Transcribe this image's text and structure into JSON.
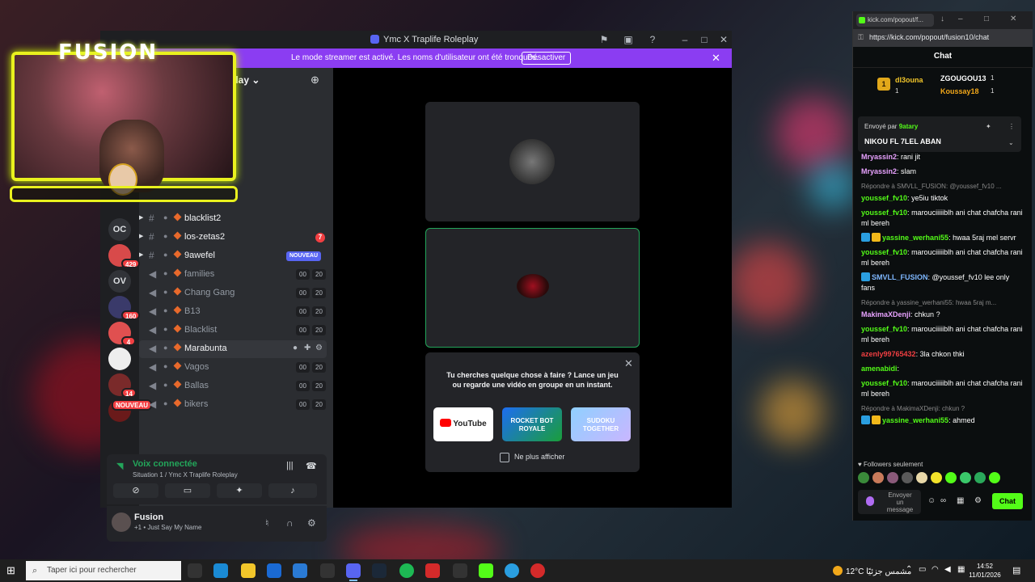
{
  "overlay": {
    "title": "FUSION"
  },
  "discord": {
    "window_title": "Ymc X Traplife Roleplay",
    "banner": {
      "message": "Le mode streamer est activé. Les noms d'utilisateur ont été tronqués.",
      "button": "Désactiver"
    },
    "guild_header": "play ⌄",
    "servers": [
      {
        "label": "OC"
      },
      {
        "label": "",
        "badge": "429"
      },
      {
        "label": "OV"
      },
      {
        "label": "",
        "badge": "160"
      },
      {
        "label": "",
        "badge": "4"
      },
      {
        "label": "",
        "badge": ""
      },
      {
        "label": "",
        "badge": "14"
      },
      {
        "label": "",
        "badge": "NOUVEAU"
      }
    ],
    "channels": [
      {
        "name": "blacklist2",
        "type": "text"
      },
      {
        "name": "los-zetas2",
        "type": "text",
        "unread": "7"
      },
      {
        "name": "9awefel",
        "type": "text",
        "nouveau": "NOUVEAU"
      },
      {
        "name": "families",
        "type": "voice",
        "c1": "00",
        "c2": "20"
      },
      {
        "name": "Chang Gang",
        "type": "voice",
        "c1": "00",
        "c2": "20"
      },
      {
        "name": "B13",
        "type": "voice",
        "c1": "00",
        "c2": "20"
      },
      {
        "name": "Blacklist",
        "type": "voice",
        "c1": "00",
        "c2": "20"
      },
      {
        "name": "Marabunta",
        "type": "voice"
      },
      {
        "name": "Vagos",
        "type": "voice",
        "c1": "00",
        "c2": "20"
      },
      {
        "name": "Ballas",
        "type": "voice",
        "c1": "00",
        "c2": "20"
      },
      {
        "name": "bikers",
        "type": "voice",
        "c1": "00",
        "c2": "20"
      }
    ],
    "voice": {
      "status": "Voix connectée",
      "location": "Situation 1 / Ymc X Traplife Roleplay"
    },
    "user": {
      "name": "Fusion",
      "status": "+1 • Just Say My Name"
    },
    "activity": {
      "text": "Tu cherches quelque chose à faire ? Lance un jeu ou regarde une vidéo en groupe en un instant.",
      "apps": [
        "YouTube",
        "ROCKET BOT ROYALE",
        "SUDOKU TOGETHER"
      ],
      "checkbox": "Ne plus afficher"
    }
  },
  "kick": {
    "tab_label": "kick.com/popout/f...",
    "url": "https://kick.com/popout/fusion10/chat",
    "header": "Chat",
    "gifters": [
      {
        "name": "dl3ouna",
        "count": "1",
        "rank": "1"
      },
      {
        "name": "ZGOUGOU13",
        "count": "1"
      },
      {
        "name": "Koussay18",
        "count": "1"
      }
    ],
    "pinned": {
      "sent_by_label": "Envoyé par",
      "sender": "9atary",
      "message": "NIKOU FL 7LEL ABAN"
    },
    "messages": [
      {
        "user": "Mryassin2",
        "color": "#e8a2ff",
        "text": "rani jit"
      },
      {
        "user": "Mryassin2",
        "color": "#e8a2ff",
        "text": "slam"
      },
      {
        "reply": "Répondre à SMVLL_FUSION: @youssef_fv10 ...",
        "user": "youssef_fv10",
        "color": "#53fc18",
        "text": "ye5iu tiktok"
      },
      {
        "user": "youssef_fv10",
        "color": "#53fc18",
        "text": "marouciiiiiblh ani chat chafcha rani ml bereh"
      },
      {
        "user": "yassine_werhani55",
        "color": "#53fc18",
        "text": "hwaa 5raj mel servr",
        "badges": true
      },
      {
        "user": "youssef_fv10",
        "color": "#53fc18",
        "text": "marouciiiiiblh ani chat chafcha rani ml bereh"
      },
      {
        "user": "SMVLL_FUSION",
        "color": "#7fb8ff",
        "text": "@youssef_fv10 lee only fans",
        "badge1": true
      },
      {
        "reply": "Répondre à yassine_werhani55: hwaa 5raj m...",
        "user": "MakimaXDenji",
        "color": "#e8a2ff",
        "text": "chkun ?"
      },
      {
        "user": "youssef_fv10",
        "color": "#53fc18",
        "text": "marouciiiiiblh ani chat chafcha rani ml bereh"
      },
      {
        "user": "azenly99765432",
        "color": "#f23f42",
        "text": "3la chkon thki"
      },
      {
        "user": "amenabidi",
        "color": "#53fc18",
        "text": ""
      },
      {
        "user": "youssef_fv10",
        "color": "#53fc18",
        "text": "marouciiiiiblh ani chat chafcha rani ml bereh"
      },
      {
        "reply": "Répondre à MakimaXDenji: chkun ?",
        "user": "yassine_werhani55",
        "color": "#53fc18",
        "text": "ahmed",
        "badges": true
      }
    ],
    "followers_only": "Followers seulement",
    "input_placeholder": "Envoyer un message",
    "send_button": "Chat"
  },
  "taskbar": {
    "search_placeholder": "Taper ici pour rechercher",
    "weather": "12°C",
    "weather_desc": "مشمس جزئيًا",
    "time": "14:52",
    "date": "11/01/2026"
  }
}
